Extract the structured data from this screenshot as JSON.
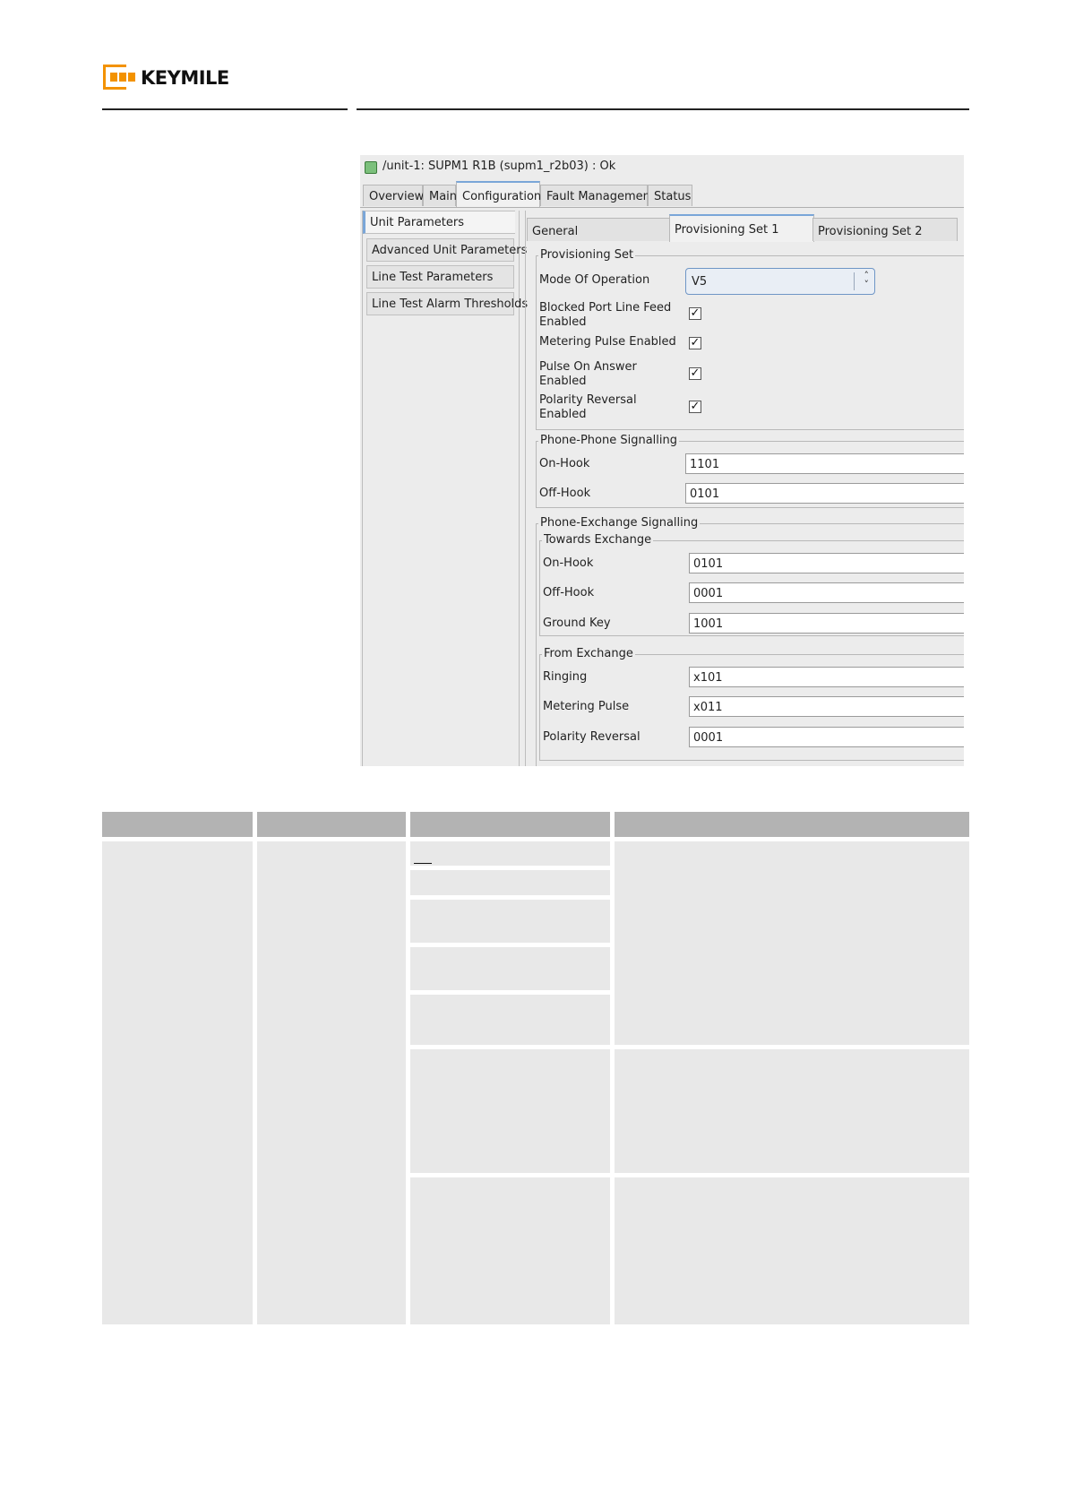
{
  "header": {
    "brand": "KEYMILE",
    "brand_color": "#f39200"
  },
  "screenshot": {
    "title": "/unit-1: SUPM1 R1B (supm1_r2b03) : Ok",
    "status_icon": "green-status-square-icon",
    "main_tabs": [
      "Overview",
      "Main",
      "Configuration",
      "Fault Management",
      "Status"
    ],
    "active_main_tab": "Configuration",
    "side_items": [
      "Unit Parameters",
      "Advanced Unit Parameters",
      "Line Test Parameters",
      "Line Test Alarm Thresholds"
    ],
    "active_side_item": "Unit Parameters",
    "sub_tabs": [
      "General",
      "Provisioning Set 1",
      "Provisioning Set 2"
    ],
    "active_sub_tab": "Provisioning Set 1",
    "provisioning_set": {
      "label": "Provisioning Set",
      "mode_label": "Mode Of Operation",
      "mode_value": "V5",
      "checks": [
        {
          "label_l1": "Blocked Port Line Feed",
          "label_l2": "Enabled",
          "checked": true
        },
        {
          "label_l1": "Metering Pulse Enabled",
          "label_l2": "",
          "checked": true
        },
        {
          "label_l1": "Pulse On Answer",
          "label_l2": "Enabled",
          "checked": true
        },
        {
          "label_l1": "Polarity Reversal",
          "label_l2": "Enabled",
          "checked": true
        }
      ]
    },
    "phone_phone": {
      "label": "Phone-Phone Signalling",
      "on_hook_label": "On-Hook",
      "on_hook_value": "1101",
      "off_hook_label": "Off-Hook",
      "off_hook_value": "0101"
    },
    "phone_exchange": {
      "label": "Phone-Exchange Signalling",
      "towards": {
        "label": "Towards Exchange",
        "on_hook_label": "On-Hook",
        "on_hook_value": "0101",
        "off_hook_label": "Off-Hook",
        "off_hook_value": "0001",
        "ground_key_label": "Ground Key",
        "ground_key_value": "1001"
      },
      "from": {
        "label": "From Exchange",
        "ringing_label": "Ringing",
        "ringing_value": "x101",
        "metering_label": "Metering Pulse",
        "metering_value": "x011",
        "polarity_label": "Polarity Reversal",
        "polarity_value": "0001"
      }
    }
  }
}
